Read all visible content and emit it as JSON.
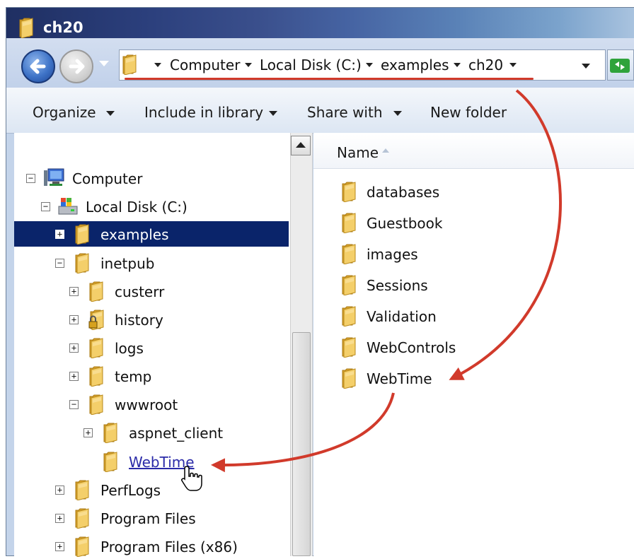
{
  "window": {
    "title": "ch20"
  },
  "address_bar": {
    "crumbs": [
      "Computer",
      "Local Disk (C:)",
      "examples",
      "ch20"
    ]
  },
  "toolbar": {
    "items": [
      "Organize",
      "Include in library",
      "Share with",
      "New folder"
    ]
  },
  "nav_tree": {
    "items": [
      {
        "label": "Computer"
      },
      {
        "label": "Local Disk (C:)"
      },
      {
        "label": "examples"
      },
      {
        "label": "inetpub"
      },
      {
        "label": "custerr"
      },
      {
        "label": "history"
      },
      {
        "label": "logs"
      },
      {
        "label": "temp"
      },
      {
        "label": "wwwroot"
      },
      {
        "label": "aspnet_client"
      },
      {
        "label": "WebTime"
      },
      {
        "label": "PerfLogs"
      },
      {
        "label": "Program Files"
      },
      {
        "label": "Program Files (x86)"
      }
    ]
  },
  "content": {
    "column_header": "Name",
    "items": [
      "databases",
      "Guestbook",
      "images",
      "Sessions",
      "Validation",
      "WebControls",
      "WebTime"
    ]
  },
  "colors": {
    "annotation_red": "#d13a2b",
    "selection": "#0a246a",
    "folder": "#e8b73a"
  }
}
